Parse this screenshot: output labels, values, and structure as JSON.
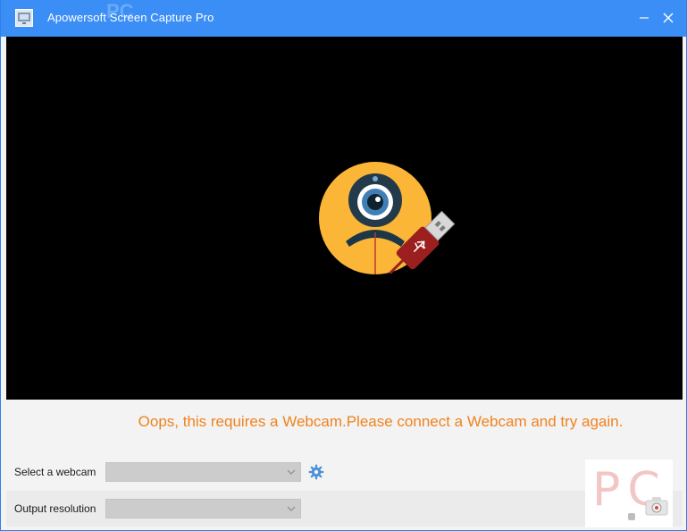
{
  "window": {
    "title": "Apowersoft Screen Capture Pro",
    "title_watermark": "PC"
  },
  "preview": {
    "illustration": "webcam-usb-disconnected-icon",
    "colors": {
      "background": "#000000",
      "circle": "#fbb637",
      "usb": "#9b1f1f"
    }
  },
  "message": "Oops, this requires a Webcam.Please connect a Webcam and try again.",
  "controls": {
    "webcam_label": "Select a webcam",
    "webcam_value": "",
    "resolution_label": "Output resolution",
    "resolution_value": ""
  },
  "watermark": {
    "text": "PC",
    "icon": "camera-icon"
  },
  "colors": {
    "titlebar": "#3a8ef6",
    "message": "#f0821e",
    "gear": "#4a90d9"
  }
}
